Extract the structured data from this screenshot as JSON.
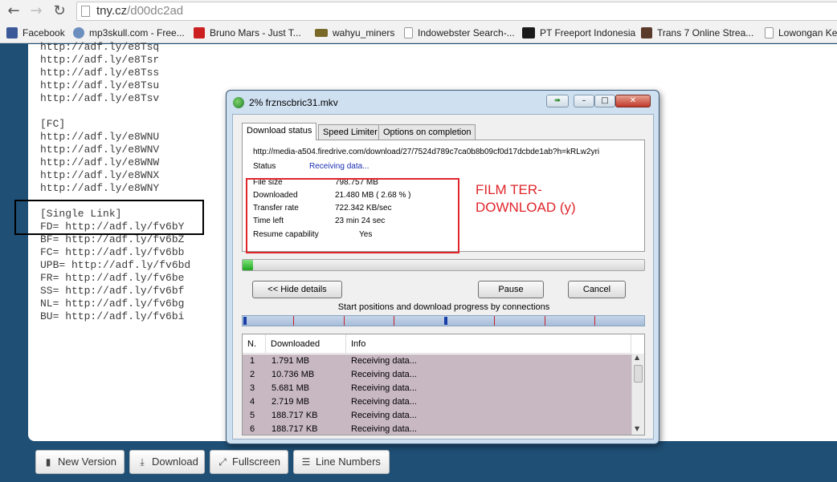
{
  "browser": {
    "url_host": "tny.cz",
    "url_path": "/d00dc2ad",
    "bookmarks": [
      {
        "label": "Facebook",
        "color": "#3b5998"
      },
      {
        "label": "mp3skull.com - Free...",
        "color": "#4a6fa5"
      },
      {
        "label": "Bruno Mars - Just T...",
        "color": "#cc1f1f"
      },
      {
        "label": "wahyu_miners",
        "color": "#7a6a2a"
      },
      {
        "label": "Indowebster Search-...",
        "color": "#ffffff"
      },
      {
        "label": "PT Freeport Indonesia",
        "color": "#1a1a1a"
      },
      {
        "label": "Trans 7 Online Strea...",
        "color": "#5a3a2a"
      },
      {
        "label": "Lowongan Ke",
        "color": "#ffffff"
      }
    ]
  },
  "paste": {
    "lines": "http://adf.ly/e8Tsq\nhttp://adf.ly/e8Tsr\nhttp://adf.ly/e8Tss\nhttp://adf.ly/e8Tsu\nhttp://adf.ly/e8Tsv\n\n[FC]\nhttp://adf.ly/e8WNU\nhttp://adf.ly/e8WNV\nhttp://adf.ly/e8WNW\nhttp://adf.ly/e8WNX\nhttp://adf.ly/e8WNY\n\n[Single Link]\nFD= http://adf.ly/fv6bY\nBF= http://adf.ly/fv6bZ\nFC= http://adf.ly/fv6bb\nUPB= http://adf.ly/fv6bd\nFR= http://adf.ly/fv6be\nSS= http://adf.ly/fv6bf\nNL= http://adf.ly/fv6bg\nBU= http://adf.ly/fv6bi"
  },
  "toolbar": {
    "new_version": "New Version",
    "download": "Download",
    "fullscreen": "Fullscreen",
    "line_numbers": "Line Numbers"
  },
  "dialog": {
    "title": "2% frznscbric31.mkv",
    "tabs": [
      "Download status",
      "Speed Limiter",
      "Options on completion"
    ],
    "url": "http://media-a504.firedrive.com/download/27/7524d789c7ca0b8b09cf0d17dcbde1ab?h=kRLw2yri",
    "status_label": "Status",
    "status_value": "Receiving data...",
    "info": [
      {
        "label": "File size",
        "value": "798.757  MB"
      },
      {
        "label": "Downloaded",
        "value": "21.480  MB  ( 2.68 % )"
      },
      {
        "label": "Transfer rate",
        "value": "722.342  KB/sec"
      },
      {
        "label": "Time left",
        "value": "23 min 24 sec"
      },
      {
        "label": "Resume capability",
        "value": "Yes"
      }
    ],
    "annotation": "FILM TER-\nDOWNLOAD (y)",
    "progress_fraction": 0.0268,
    "hide_details": "<< Hide details",
    "pause": "Pause",
    "cancel": "Cancel",
    "connections_label": "Start positions and download progress by connections",
    "columns": [
      "N.",
      "Downloaded",
      "Info"
    ],
    "rows": [
      {
        "n": "1",
        "downloaded": "1.791  MB",
        "info": "Receiving data..."
      },
      {
        "n": "2",
        "downloaded": "10.736  MB",
        "info": "Receiving data..."
      },
      {
        "n": "3",
        "downloaded": "5.681  MB",
        "info": "Receiving data..."
      },
      {
        "n": "4",
        "downloaded": "2.719  MB",
        "info": "Receiving data..."
      },
      {
        "n": "5",
        "downloaded": "188.717  KB",
        "info": "Receiving data..."
      },
      {
        "n": "6",
        "downloaded": "188.717  KB",
        "info": "Receiving data..."
      }
    ]
  }
}
